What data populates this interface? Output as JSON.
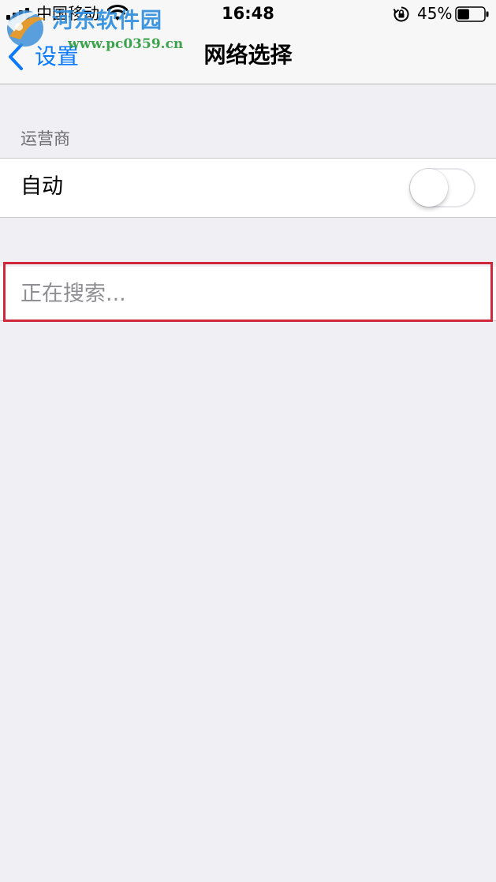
{
  "status_bar": {
    "carrier": "中国移动",
    "time": "16:48",
    "battery_percent": "45%",
    "battery_level": 0.45,
    "icons": [
      "signal-icon",
      "wifi-icon",
      "rotation-lock-icon",
      "battery-icon"
    ]
  },
  "watermark": {
    "title": "河东软件园",
    "url": "www.pc0359.cn"
  },
  "nav_bar": {
    "back_label": "设置",
    "title": "网络选择"
  },
  "carrier_section": {
    "header": "运营商",
    "auto_label": "自动",
    "auto_enabled": false
  },
  "search_status": {
    "text": "正在搜索..."
  },
  "colors": {
    "accent": "#0a7aff",
    "background": "#efeff4",
    "highlight": "#d0283a",
    "watermark_blue": "#2e8ede",
    "watermark_green": "#2a9a3c"
  }
}
